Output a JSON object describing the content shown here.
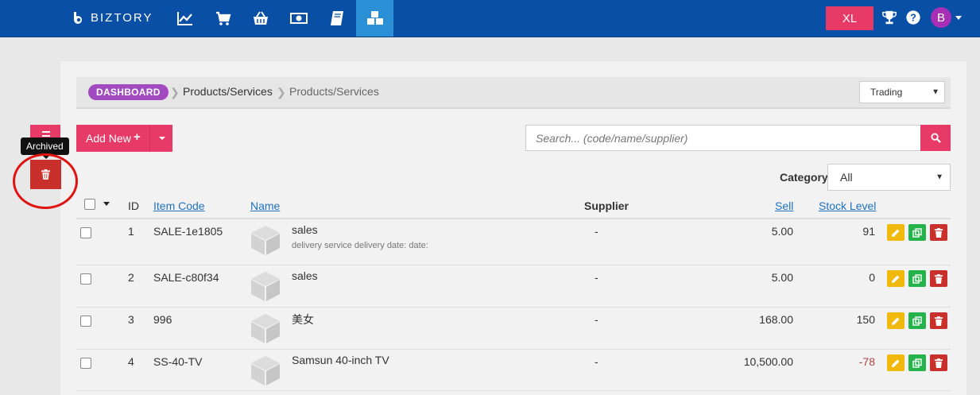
{
  "topbar": {
    "logo": "BIZTORY",
    "nav": [
      {
        "icon": "line-chart-icon"
      },
      {
        "icon": "shopping-cart-icon"
      },
      {
        "icon": "basket-icon"
      },
      {
        "icon": "money-icon"
      },
      {
        "icon": "book-icon"
      },
      {
        "icon": "cubes-icon",
        "active": true
      }
    ],
    "xl_label": "XL",
    "trophy_icon": "trophy-icon",
    "help_icon": "question-circle-icon",
    "avatar_letter": "B"
  },
  "breadcrumb": {
    "dashboard": "DASHBOARD",
    "items": [
      "Products/Services",
      "Products/Services"
    ]
  },
  "trading_select": {
    "value": "Trading"
  },
  "sidebar": {
    "tooltip": "Archived",
    "menu_icon": "list-icon",
    "archive_icon": "trash-icon"
  },
  "toolbar": {
    "add_new_label": "Add New",
    "add_new_plus": "+",
    "search_placeholder": "Search... (code/name/supplier)"
  },
  "filter": {
    "category_label": "Category",
    "category_value": "All"
  },
  "table": {
    "headers": {
      "id": "ID",
      "item_code": "Item Code",
      "name": "Name",
      "supplier": "Supplier",
      "sell": "Sell",
      "stock_level": "Stock Level"
    },
    "rows": [
      {
        "id": "1",
        "code": "SALE-1e1805",
        "name": "sales",
        "desc": "delivery service delivery date: date:",
        "supplier": "-",
        "sell": "5.00",
        "stock": "91"
      },
      {
        "id": "2",
        "code": "SALE-c80f34",
        "name": "sales",
        "desc": "",
        "supplier": "-",
        "sell": "5.00",
        "stock": "0"
      },
      {
        "id": "3",
        "code": "996",
        "name": "美女",
        "desc": "",
        "supplier": "-",
        "sell": "168.00",
        "stock": "150"
      },
      {
        "id": "4",
        "code": "SS-40-TV",
        "name": "Samsun 40-inch TV",
        "desc": "",
        "supplier": "-",
        "sell": "10,500.00",
        "stock": "-78"
      }
    ]
  },
  "colors": {
    "topbar": "#0a4fa6",
    "accent_pink": "#e83a67",
    "danger": "#c9302c",
    "success": "#24b24a",
    "warning": "#f0b90b",
    "purple": "#a24bc0"
  }
}
